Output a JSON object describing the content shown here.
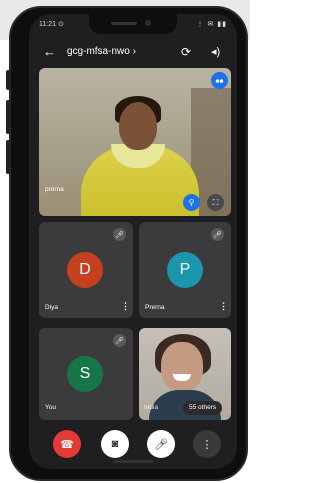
{
  "status_bar": {
    "time": "11:21 ⊙",
    "icons": "⋮ ✉ ▮▮"
  },
  "toolbar": {
    "back_glyph": "←",
    "meeting_code": "gcg-mfsa-nwo ›",
    "switch_camera_glyph": "⟳",
    "audio_glyph": "◂)"
  },
  "main_tile": {
    "name": "prerna",
    "pin_glyph": "⚲",
    "fullscreen_glyph": "⛶",
    "speaking_glyph": "⦁⦁"
  },
  "participants": [
    {
      "name": "Diya",
      "initial": "D",
      "color": "#c5401f"
    },
    {
      "name": "Prerna",
      "initial": "P",
      "color": "#1b96ad"
    },
    {
      "name": "You",
      "initial": "S",
      "color": "#177648"
    }
  ],
  "camera_tile": {
    "name": "India",
    "others_label": "55 others"
  },
  "icons": {
    "mute": "🎤︎",
    "more": "⋮"
  },
  "controls": {
    "end_glyph": "☎",
    "video_glyph": "◙",
    "mic_glyph": "🎤︎",
    "more_glyph": "⋮",
    "colors": {
      "end": "#e53935",
      "video": "#ffffff",
      "mic": "#ffffff",
      "more": "#3a3a3d"
    }
  }
}
